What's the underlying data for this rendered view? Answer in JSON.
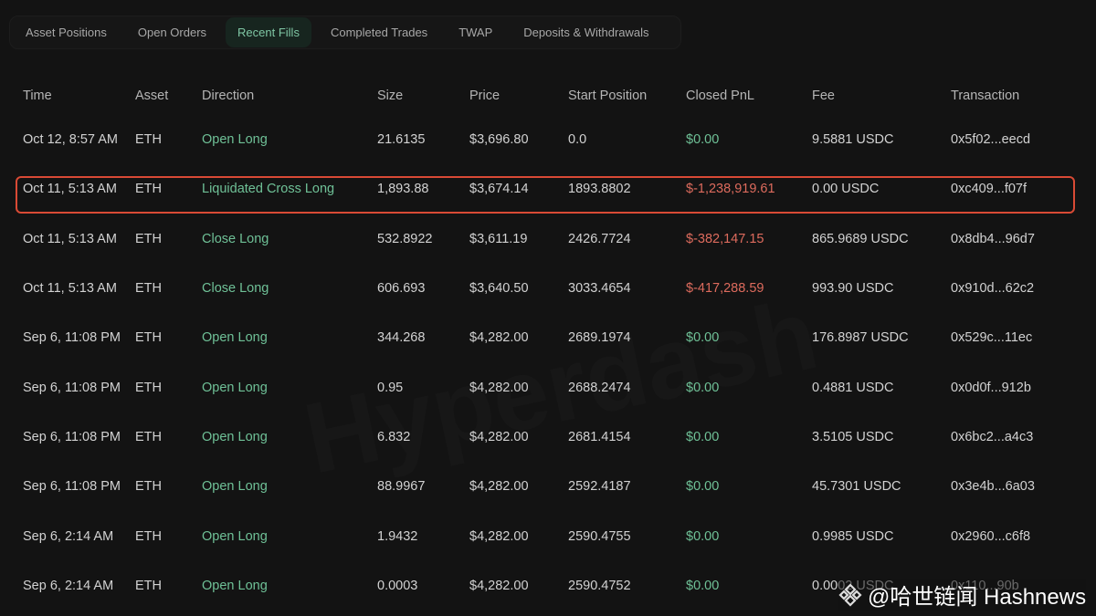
{
  "tabs": [
    {
      "label": "Asset Positions"
    },
    {
      "label": "Open Orders"
    },
    {
      "label": "Recent Fills",
      "active": true
    },
    {
      "label": "Completed Trades"
    },
    {
      "label": "TWAP"
    },
    {
      "label": "Deposits & Withdrawals"
    }
  ],
  "columns": [
    "Time",
    "Asset",
    "Direction",
    "Size",
    "Price",
    "Start Position",
    "Closed PnL",
    "Fee",
    "Transaction"
  ],
  "rows": [
    {
      "time": "Oct 12, 8:57 AM",
      "asset": "ETH",
      "direction": "Open Long",
      "size": "21.6135",
      "price": "$3,696.80",
      "start": "0.0",
      "pnl": "$0.00",
      "pnl_sign": "pos",
      "fee": "9.5881 USDC",
      "tx": "0x5f02...eecd"
    },
    {
      "time": "Oct 11, 5:13 AM",
      "asset": "ETH",
      "direction": "Liquidated Cross Long",
      "size": "1,893.88",
      "price": "$3,674.14",
      "start": "1893.8802",
      "pnl": "$-1,238,919.61",
      "pnl_sign": "neg",
      "fee": "0.00 USDC",
      "tx": "0xc409...f07f",
      "highlighted": true
    },
    {
      "time": "Oct 11, 5:13 AM",
      "asset": "ETH",
      "direction": "Close Long",
      "size": "532.8922",
      "price": "$3,611.19",
      "start": "2426.7724",
      "pnl": "$-382,147.15",
      "pnl_sign": "neg",
      "fee": "865.9689 USDC",
      "tx": "0x8db4...96d7"
    },
    {
      "time": "Oct 11, 5:13 AM",
      "asset": "ETH",
      "direction": "Close Long",
      "size": "606.693",
      "price": "$3,640.50",
      "start": "3033.4654",
      "pnl": "$-417,288.59",
      "pnl_sign": "neg",
      "fee": "993.90 USDC",
      "tx": "0x910d...62c2"
    },
    {
      "time": "Sep 6, 11:08 PM",
      "asset": "ETH",
      "direction": "Open Long",
      "size": "344.268",
      "price": "$4,282.00",
      "start": "2689.1974",
      "pnl": "$0.00",
      "pnl_sign": "pos",
      "fee": "176.8987 USDC",
      "tx": "0x529c...11ec"
    },
    {
      "time": "Sep 6, 11:08 PM",
      "asset": "ETH",
      "direction": "Open Long",
      "size": "0.95",
      "price": "$4,282.00",
      "start": "2688.2474",
      "pnl": "$0.00",
      "pnl_sign": "pos",
      "fee": "0.4881 USDC",
      "tx": "0x0d0f...912b"
    },
    {
      "time": "Sep 6, 11:08 PM",
      "asset": "ETH",
      "direction": "Open Long",
      "size": "6.832",
      "price": "$4,282.00",
      "start": "2681.4154",
      "pnl": "$0.00",
      "pnl_sign": "pos",
      "fee": "3.5105 USDC",
      "tx": "0x6bc2...a4c3"
    },
    {
      "time": "Sep 6, 11:08 PM",
      "asset": "ETH",
      "direction": "Open Long",
      "size": "88.9967",
      "price": "$4,282.00",
      "start": "2592.4187",
      "pnl": "$0.00",
      "pnl_sign": "pos",
      "fee": "45.7301 USDC",
      "tx": "0x3e4b...6a03"
    },
    {
      "time": "Sep 6, 2:14 AM",
      "asset": "ETH",
      "direction": "Open Long",
      "size": "1.9432",
      "price": "$4,282.00",
      "start": "2590.4755",
      "pnl": "$0.00",
      "pnl_sign": "pos",
      "fee": "0.9985 USDC",
      "tx": "0x2960...c6f8"
    },
    {
      "time": "Sep 6, 2:14 AM",
      "asset": "ETH",
      "direction": "Open Long",
      "size": "0.0003",
      "price": "$4,282.00",
      "start": "2590.4752",
      "pnl": "$0.00",
      "pnl_sign": "pos",
      "fee": "0.0002 USDC",
      "tx": "0x110...90b"
    }
  ],
  "watermark": {
    "text": "@哈世链闻 Hashnews"
  },
  "background_mark": "Hyperdash",
  "colors": {
    "positive": "#6fc197",
    "negative": "#dd6b5d",
    "highlight": "#d94a35"
  }
}
